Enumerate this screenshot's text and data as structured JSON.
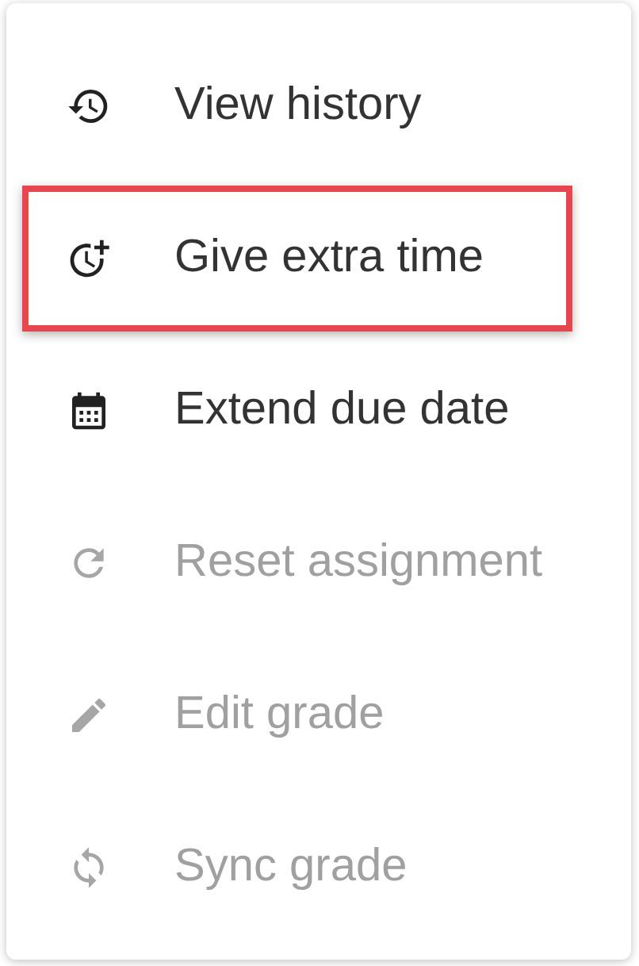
{
  "menu": {
    "items": [
      {
        "label": "View history",
        "disabled": false,
        "highlighted": false
      },
      {
        "label": "Give extra time",
        "disabled": false,
        "highlighted": true
      },
      {
        "label": "Extend due date",
        "disabled": false,
        "highlighted": false
      },
      {
        "label": "Reset assignment",
        "disabled": true,
        "highlighted": false
      },
      {
        "label": "Edit grade",
        "disabled": true,
        "highlighted": false
      },
      {
        "label": "Sync grade",
        "disabled": true,
        "highlighted": false
      }
    ]
  }
}
